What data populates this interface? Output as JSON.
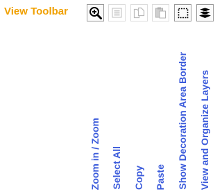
{
  "toolbar": {
    "title": "View Toolbar",
    "colors": {
      "title": "#f0a000",
      "label": "#3b5bdb"
    },
    "buttons": [
      {
        "icon": "zoom-in-icon",
        "label": "Zoom in / Zoom",
        "enabled": true
      },
      {
        "icon": "select-all-icon",
        "label": "Select All",
        "enabled": false
      },
      {
        "icon": "copy-icon",
        "label": "Copy",
        "enabled": false
      },
      {
        "icon": "paste-icon",
        "label": "Paste",
        "enabled": false
      },
      {
        "icon": "decoration-border-icon",
        "label": "Show Decoration Area Border",
        "enabled": true
      },
      {
        "icon": "layers-icon",
        "label": "View and Organize Layers",
        "enabled": true
      }
    ]
  }
}
